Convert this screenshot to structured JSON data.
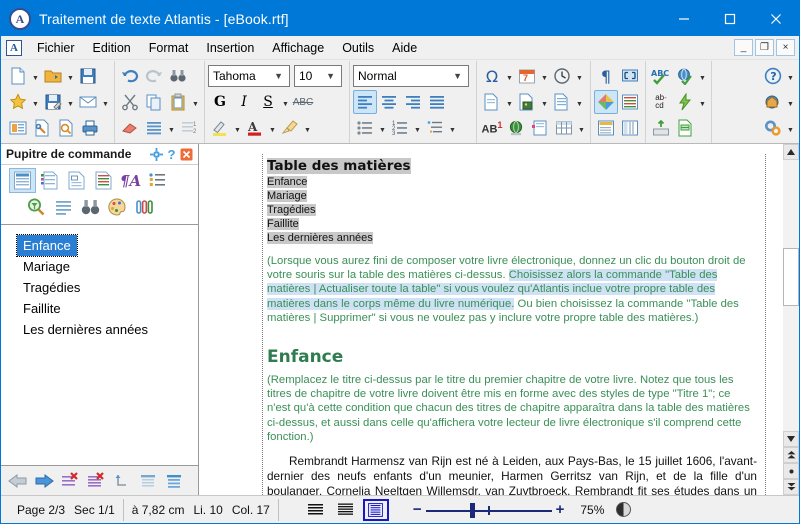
{
  "window": {
    "title": "Traitement de texte Atlantis - [eBook.rtf]",
    "app_icon": "A",
    "minimize": "minimize-icon",
    "maximize": "maximize-icon",
    "close": "close-icon"
  },
  "menubar": {
    "doc_icon": "A",
    "items": [
      "Fichier",
      "Edition",
      "Format",
      "Insertion",
      "Affichage",
      "Outils",
      "Aide"
    ],
    "mdi_buttons": [
      "_",
      "❐",
      "×"
    ]
  },
  "toolbar": {
    "font_name": "Tahoma",
    "font_size": "10",
    "style_name": "Normal",
    "groups": [
      {
        "name": "file-group",
        "rows": [
          [
            "new-document-icon",
            "open-folder-icon",
            "save-icon"
          ],
          [
            "favorites-star-icon",
            "save-as-icon",
            "send-mail-icon"
          ],
          [
            "page-setup-icon",
            "document-properties-icon",
            "print-preview-icon",
            "print-icon"
          ]
        ]
      },
      {
        "name": "edit-group",
        "rows": [
          [
            "undo-icon",
            "redo-icon",
            "find-binoculars-icon"
          ],
          [
            "cut-scissors-icon",
            "copy-icon",
            "paste-icon"
          ],
          [
            "eraser-icon",
            "format-painter-lines-icon",
            "clear-formatting-icon"
          ]
        ]
      },
      {
        "name": "font-group",
        "rows": [
          [
            "font-name-combo",
            "font-size-combo"
          ],
          [
            "bold-icon",
            "italic-icon",
            "underline-icon",
            "strikethrough-icon"
          ],
          [
            "highlight-pen-icon",
            "font-color-icon",
            "paintbrush-icon"
          ]
        ]
      },
      {
        "name": "paragraph-group",
        "rows": [
          [
            "style-combo"
          ],
          [
            "align-left-icon",
            "align-center-icon",
            "align-right-icon",
            "align-justify-icon"
          ],
          [
            "bullet-list-icon",
            "numbered-list-icon",
            "multilevel-list-icon"
          ]
        ]
      },
      {
        "name": "insert-group",
        "rows": [
          [
            "symbol-omega-icon",
            "insert-date-icon",
            "insert-time-icon"
          ],
          [
            "insert-file-icon",
            "insert-picture-icon",
            "insert-object-icon"
          ],
          [
            "footnote-icon",
            "hyperlink-globe-icon",
            "bookmark-icon",
            "insert-table-icon"
          ]
        ]
      },
      {
        "name": "view-group",
        "rows": [
          [
            "show-marks-pilcrow-icon",
            "full-screen-icon"
          ],
          [
            "color-scheme-icon",
            "document-map-icon"
          ],
          [
            "header-footer-icon",
            "ruler-icon"
          ]
        ]
      },
      {
        "name": "tools-group",
        "rows": [
          [
            "spell-check-icon",
            "language-globe-icon"
          ],
          [
            "autocorrect-abcd-icon",
            "power-typing-icon"
          ],
          [
            "autotext-keyboard-icon",
            "mail-merge-icon"
          ]
        ]
      },
      {
        "name": "help-group",
        "rows": [
          [
            "help-question-icon"
          ],
          [
            "home-page-globe-icon"
          ],
          [
            "options-gears-icon"
          ]
        ]
      }
    ]
  },
  "control_panel": {
    "title": "Pupitre de commande",
    "header_buttons": [
      "gear-icon",
      "help-icon",
      "close-panel-icon"
    ],
    "tools_row1": [
      "outline-view-icon",
      "styles-list-icon",
      "document-info-icon",
      "formatting-list-icon",
      "font-styles-icon",
      "list-styles-icon"
    ],
    "tools_row2": [
      "find-zoom-icon",
      "paragraph-lines-icon",
      "binoculars-icon",
      "palette-icon",
      "clips-icon"
    ],
    "items": [
      {
        "label": "Enfance",
        "selected": true
      },
      {
        "label": "Mariage",
        "selected": false
      },
      {
        "label": "Tragédies",
        "selected": false
      },
      {
        "label": "Faillite",
        "selected": false
      },
      {
        "label": "Les dernières années",
        "selected": false
      }
    ],
    "bottom_tools": [
      "back-arrow-icon",
      "forward-arrow-icon",
      "delete-item-icon",
      "delete-all-icon",
      "promote-icon",
      "collapse-icon",
      "expand-icon"
    ]
  },
  "document": {
    "toc_heading": "Table des matières",
    "toc_entries": [
      "Enfance",
      "Mariage",
      "Tragédies",
      "Faillite",
      "Les dernières années"
    ],
    "note_before_selection": "(Lorsque vous aurez fini de composer votre livre électronique, donnez un clic du bouton droit de votre souris sur la table des matières ci-dessus. ",
    "note_selected": "Choisissez alors la commande \"Table des matières | Actualiser toute la table\" si vous voulez qu'Atlantis inclue votre propre table des matières dans le corps même du livre numérique.",
    "note_after_selection": " Ou bien choisissez la commande \"Table des matières | Supprimer\" si vous ne voulez pas y inclure votre propre table des matières.)",
    "chapter_title": "Enfance",
    "chapter_note": "(Remplacez le titre ci-dessus par le titre du premier chapitre de votre livre. Notez que tous les titres de chapitre de votre livre doivent être mis en forme avec des styles de type \"Titre 1\"; ce n'est qu'à cette condition que chacun des titres de chapitre apparaîtra dans la table des matières ci-dessus, et aussi dans celle qu'affichera votre lecteur de livre électronique s'il comprend cette fonction.)",
    "body_paragraph": "Rembrandt Harmensz van Rijn est né à Leiden, aux Pays-Bas, le 15 juillet 1606, l'avant-dernier des neufs enfants d'un meunier, Harmen Gerritsz van Rijn, et de la fille d'un boulanger, Cornelia Neeltgen Willemsdr. van Zuytbroeck. Rembrandt fit ses études dans un lycée classique pendant sept ans, puis entra à l'université de Leiden en 1620, à treize ans. Quelques mois plus"
  },
  "scrollbar": {
    "up_arrow": "scroll-up-icon",
    "down_arrow": "scroll-down-icon",
    "prev_page": "previous-page-icon",
    "select_object": "select-browse-object-icon",
    "next_page": "next-page-icon"
  },
  "statusbar": {
    "page": "Page 2/3",
    "section": "Sec 1/1",
    "position": "à 7,82 cm",
    "line": "Li. 10",
    "column": "Col. 17",
    "view_buttons": [
      "normal-view-icon",
      "web-view-icon",
      "print-layout-view-icon"
    ],
    "selected_view_index": 2,
    "zoom_minus": "−",
    "zoom_plus": "+",
    "zoom_value": "75%",
    "contrast_icon": "contrast-icon"
  },
  "colors": {
    "titlebar": "#0078d7",
    "accent": "#0078d7",
    "selection": "#cfe2f5",
    "green_text": "#3a8f57",
    "highlight_gray": "#c8c8c8",
    "list_selected": "#2a7fd4"
  }
}
